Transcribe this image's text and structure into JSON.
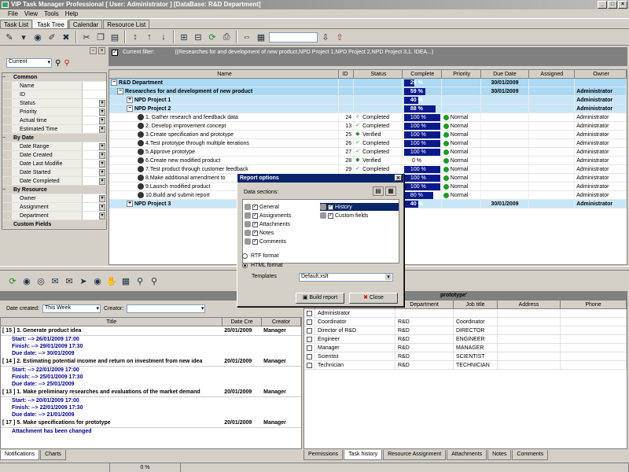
{
  "window": {
    "title": "VIP Task Manager Professional [ User: Administrator ] [DataBase: R&D Department]"
  },
  "menu": [
    "File",
    "View",
    "Tools",
    "Help"
  ],
  "view_tabs": [
    "Task List",
    "Task Tree",
    "Calendar",
    "Resource List"
  ],
  "active_view_tab": 1,
  "filter": {
    "label": "Current filter:",
    "text": "((Researches for and development of new product,NPD Project 1,NPD Project 2,NPD Project 3,1. IDEA...)"
  },
  "left_panel": {
    "filter_select": "Current",
    "categories": [
      {
        "name": "Common",
        "items": [
          "Name",
          "ID",
          "Status",
          "Priority",
          "Actual time",
          "Estimated Time"
        ]
      },
      {
        "name": "By Date",
        "items": [
          "Date Range",
          "Date Created",
          "Date Last Modifie",
          "Date Started",
          "Date Completed"
        ]
      },
      {
        "name": "By Resource",
        "items": [
          "Owner",
          "Assignment",
          "Department"
        ]
      },
      {
        "name": "Custom Fields",
        "items": []
      }
    ]
  },
  "task_grid": {
    "columns": [
      "Name",
      "ID",
      "Status",
      "Complete",
      "Priority",
      "Due Date",
      "Assigned",
      "Owner"
    ],
    "rows": [
      {
        "kind": "root",
        "name": "R&D Department",
        "id": "",
        "status": "",
        "complete": "29 %",
        "pct": 29,
        "priority": "",
        "due": "30/01/2009",
        "assigned": "",
        "owner": ""
      },
      {
        "kind": "sum",
        "name": "Researches for and development of new product",
        "id": "",
        "status": "",
        "complete": "59 %",
        "pct": 59,
        "priority": "",
        "due": "30/01/2009",
        "assigned": "",
        "owner": "Administrator"
      },
      {
        "kind": "proj",
        "name": "NPD Project 1",
        "id": "",
        "status": "",
        "complete": "40 %",
        "pct": 40,
        "priority": "",
        "due": "",
        "assigned": "",
        "owner": "Administrator"
      },
      {
        "kind": "proj",
        "name": "NPD Project 2",
        "id": "",
        "status": "",
        "complete": "88 %",
        "pct": 88,
        "priority": "",
        "due": "",
        "assigned": "",
        "owner": "Administrator"
      },
      {
        "kind": "task",
        "name": "1. Gather research and feedback data",
        "id": "24",
        "status": "Completed",
        "complete": "100 %",
        "pct": 100,
        "priority": "Normal",
        "due": "",
        "assigned": "",
        "owner": "Administrator"
      },
      {
        "kind": "task",
        "name": "2. Develop improvement concept",
        "id": "13",
        "status": "Completed",
        "complete": "100 %",
        "pct": 100,
        "priority": "Normal",
        "due": "",
        "assigned": "",
        "owner": "Administrator"
      },
      {
        "kind": "task",
        "name": "3.Create specification and prototype",
        "id": "25",
        "status": "Verified",
        "complete": "100 %",
        "pct": 100,
        "priority": "Normal",
        "due": "",
        "assigned": "",
        "owner": "Administrator"
      },
      {
        "kind": "task",
        "name": "4.Test prototype through multiple iterations",
        "id": "26",
        "status": "Completed",
        "complete": "100 %",
        "pct": 100,
        "priority": "Normal",
        "due": "",
        "assigned": "",
        "owner": "Administrator"
      },
      {
        "kind": "task",
        "name": "5.Approve prototype",
        "id": "27",
        "status": "Completed",
        "complete": "100 %",
        "pct": 100,
        "priority": "Normal",
        "due": "",
        "assigned": "",
        "owner": "Administrator"
      },
      {
        "kind": "task",
        "name": "6.Create new modified product",
        "id": "28",
        "status": "Verified",
        "complete": "0 %",
        "pct": 0,
        "priority": "Normal",
        "due": "",
        "assigned": "",
        "owner": "Administrator"
      },
      {
        "kind": "task",
        "name": "7.Test product through customer feedback",
        "id": "29",
        "status": "Completed",
        "complete": "100 %",
        "pct": 100,
        "priority": "Normal",
        "due": "",
        "assigned": "",
        "owner": "Administrator"
      },
      {
        "kind": "task",
        "name": "8.Make additional amendment to",
        "id": "",
        "status": "",
        "complete": "100 %",
        "pct": 100,
        "priority": "Normal",
        "due": "",
        "assigned": "",
        "owner": "Administrator"
      },
      {
        "kind": "task",
        "name": "9.Launch modified product",
        "id": "",
        "status": "",
        "complete": "100 %",
        "pct": 100,
        "priority": "Normal",
        "due": "",
        "assigned": "",
        "owner": "Administrator"
      },
      {
        "kind": "task",
        "name": "10.Build and submit report",
        "id": "",
        "status": "",
        "complete": "80 %",
        "pct": 80,
        "priority": "Normal",
        "due": "",
        "assigned": "",
        "owner": "Administrator"
      },
      {
        "kind": "proj",
        "name": "NPD Project 3",
        "id": "",
        "status": "",
        "complete": "40 %",
        "pct": 40,
        "priority": "",
        "due": "30/01/2009",
        "assigned": "",
        "owner": "Administrator"
      }
    ]
  },
  "notifications": {
    "date_created_label": "Date created:",
    "date_created_value": "This Week",
    "creator_label": "Creator:",
    "columns": [
      "Title",
      "Date Cre",
      "Creator"
    ],
    "items": [
      {
        "title": "[ 15 ] 3. Generate product idea",
        "date": "20/01/2009",
        "creator": "Manager",
        "lines": [
          "Start: --> 26/01/2009 17:00",
          "Finish: --> 29/01/2009 17:30",
          "Due date: --> 30/01/2009"
        ]
      },
      {
        "title": "[ 14 ] 2. Estimating potential income and return on investment from new idea",
        "date": "20/01/2009",
        "creator": "Manager",
        "lines": [
          "Start: --> 22/01/2009 17:00",
          "Finish: --> 25/01/2009 17:30",
          "Due date: --> 25/01/2009"
        ]
      },
      {
        "title": "[ 13 ] 1. Make preliminary researches and evaluations of the market demand",
        "date": "20/01/2009",
        "creator": "Manager",
        "lines": [
          "Start: --> 20/01/2009 17:00",
          "Finish: --> 22/01/2009 17:30",
          "Due date: --> 21/01/2009"
        ]
      },
      {
        "title": "[ 17 ] 5. Make specifications for prototype",
        "date": "20/01/2009",
        "creator": "Manager",
        "lines": [
          "Attachment has been changed"
        ]
      }
    ],
    "tabs": [
      "Notifications",
      "Charts"
    ]
  },
  "resources": {
    "header_title": "prototype'",
    "columns": [
      "Department",
      "Job title",
      "Address",
      "Phone"
    ],
    "rows": [
      {
        "name": "Administrator",
        "dept": "",
        "job": ""
      },
      {
        "name": "Coordinator",
        "dept": "R&D",
        "job": "Coordinator"
      },
      {
        "name": "Director of R&D",
        "dept": "R&D",
        "job": "DIRECTOR"
      },
      {
        "name": "Engineer",
        "dept": "R&D",
        "job": "ENGINEER"
      },
      {
        "name": "Manager",
        "dept": "R&D",
        "job": "MANAGER"
      },
      {
        "name": "Scientist",
        "dept": "R&D",
        "job": "SCIENTIST"
      },
      {
        "name": "Technician",
        "dept": "R&D",
        "job": "TECHNICIAN"
      }
    ],
    "tabs": [
      "Permissions",
      "Task history",
      "Resource Assignment",
      "Attachments",
      "Notes",
      "Comments"
    ]
  },
  "dialog": {
    "title": "Report options",
    "sections_label": "Data sections:",
    "sections_left": [
      "General",
      "Assignments",
      "Attachments",
      "Notes",
      "Comments"
    ],
    "sections_right": [
      "History",
      "Custom fields"
    ],
    "rtf_label": "RTF format",
    "html_label": "HTML format",
    "templates_label": "Templates",
    "template_value": "Default.xslt",
    "build_label": "Build report",
    "close_label": "Close"
  },
  "status": {
    "progress": "0 %"
  },
  "colors": {
    "accent": "#0a1a8a",
    "sum_row": "#a9d9f5",
    "dialog_title": "#0a246a"
  }
}
